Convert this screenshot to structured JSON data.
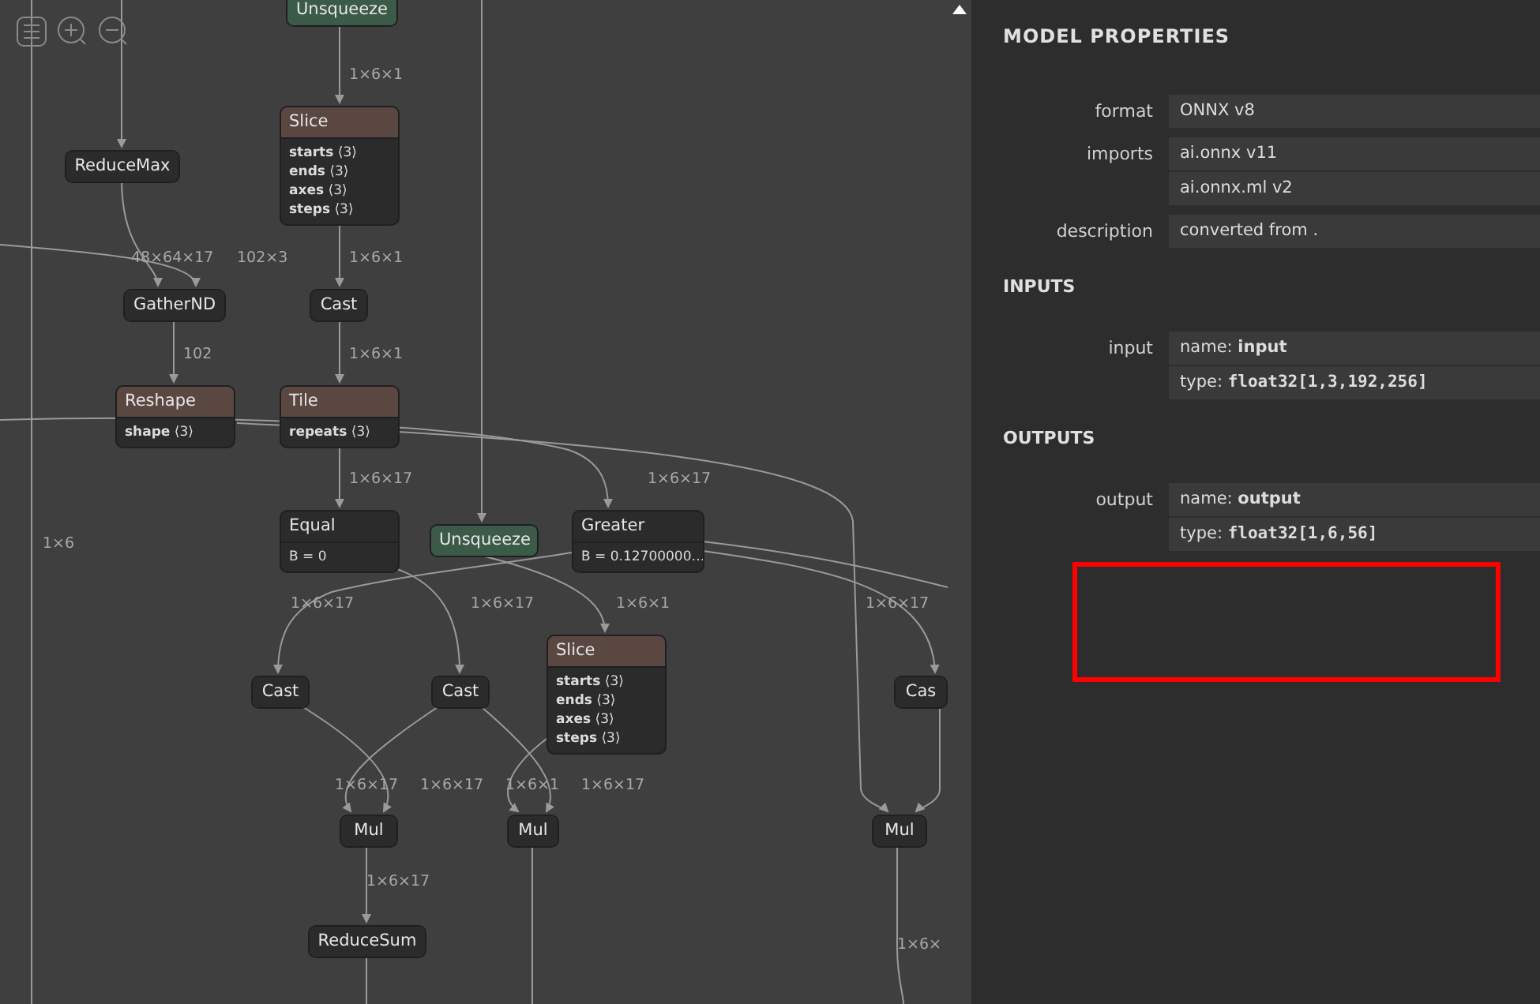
{
  "graph": {
    "nodes": [
      {
        "op": "Unsqueeze",
        "kind": "reshaping"
      },
      {
        "op": "ReduceMax",
        "kind": "basic"
      },
      {
        "op": "Slice",
        "kind": "layer",
        "attributes": [
          {
            "name": "starts",
            "value": "⟨3⟩"
          },
          {
            "name": "ends",
            "value": "⟨3⟩"
          },
          {
            "name": "axes",
            "value": "⟨3⟩"
          },
          {
            "name": "steps",
            "value": "⟨3⟩"
          }
        ]
      },
      {
        "op": "GatherND",
        "kind": "basic"
      },
      {
        "op": "Cast",
        "kind": "basic"
      },
      {
        "op": "Reshape",
        "kind": "layer",
        "attributes": [
          {
            "name": "shape",
            "value": "⟨3⟩"
          }
        ]
      },
      {
        "op": "Tile",
        "kind": "layer",
        "attributes": [
          {
            "name": "repeats",
            "value": "⟨3⟩"
          }
        ]
      },
      {
        "op": "Equal",
        "kind": "basic",
        "initializers": [
          "B = 0"
        ]
      },
      {
        "op": "Unsqueeze",
        "kind": "reshaping"
      },
      {
        "op": "Greater",
        "kind": "basic",
        "initializers": [
          "B = 0.12700000…"
        ]
      },
      {
        "op": "Cast",
        "kind": "basic"
      },
      {
        "op": "Cast",
        "kind": "basic"
      },
      {
        "op": "Slice",
        "kind": "layer",
        "attributes": [
          {
            "name": "starts",
            "value": "⟨3⟩"
          },
          {
            "name": "ends",
            "value": "⟨3⟩"
          },
          {
            "name": "axes",
            "value": "⟨3⟩"
          },
          {
            "name": "steps",
            "value": "⟨3⟩"
          }
        ]
      },
      {
        "op": "Cas",
        "kind": "basic"
      },
      {
        "op": "Mul",
        "kind": "basic"
      },
      {
        "op": "Mul",
        "kind": "basic"
      },
      {
        "op": "Mul",
        "kind": "basic"
      },
      {
        "op": "ReduceSum",
        "kind": "basic"
      }
    ],
    "edge_labels": [
      "1×6×1",
      "48×64×17",
      "102×3",
      "1×6×1",
      "102",
      "1×6×1",
      "1×6×17",
      "1×6×17",
      "1×6",
      "1×6×17",
      "1×6×17",
      "1×6×1",
      "1×6×17",
      "1×6×17",
      "1×6×17",
      "1×6×1",
      "1×6×17",
      "1×6×17",
      "1×6×"
    ]
  },
  "properties_panel": {
    "title": "MODEL PROPERTIES",
    "properties": [
      {
        "label": "format",
        "values": [
          "ONNX v8"
        ]
      },
      {
        "label": "imports",
        "values": [
          "ai.onnx v11",
          "ai.onnx.ml v2"
        ]
      },
      {
        "label": "description",
        "values": [
          "converted from ."
        ]
      }
    ],
    "sections": [
      {
        "heading": "INPUTS",
        "items": [
          {
            "label": "input",
            "lines": [
              {
                "kind": "name",
                "key": "name:",
                "value": "input"
              },
              {
                "kind": "type",
                "key": "type:",
                "value": "float32[1,3,192,256]"
              }
            ]
          }
        ]
      },
      {
        "heading": "OUTPUTS",
        "items": [
          {
            "label": "output",
            "lines": [
              {
                "kind": "name",
                "key": "name:",
                "value": "output"
              },
              {
                "kind": "type",
                "key": "type:",
                "value": "float32[1,6,56]"
              }
            ]
          }
        ]
      }
    ]
  },
  "annotation": {
    "kind": "highlight"
  }
}
